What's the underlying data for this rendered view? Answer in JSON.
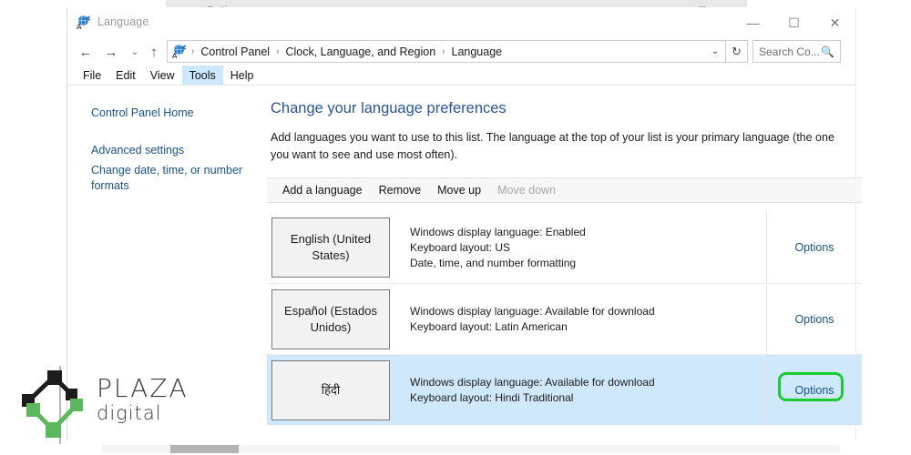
{
  "background_window": {
    "title": "Settings",
    "back_icon": "arrow-left-icon",
    "controls": [
      {
        "name": "minimize",
        "glyph": "—"
      },
      {
        "name": "maximize",
        "glyph": "☐"
      },
      {
        "name": "close",
        "glyph": "✕"
      }
    ]
  },
  "window": {
    "title": "Language",
    "icon": "language-globe-icon",
    "controls": [
      {
        "name": "minimize",
        "glyph": "—"
      },
      {
        "name": "maximize",
        "glyph": "☐"
      },
      {
        "name": "close",
        "glyph": "✕"
      }
    ]
  },
  "navigation": {
    "back": "←",
    "forward": "→",
    "recent": "⌄",
    "up": "↑",
    "breadcrumbs": [
      "Control Panel",
      "Clock, Language, and Region",
      "Language"
    ],
    "separator": "›",
    "chevron": "⌄",
    "refresh": "↻"
  },
  "search": {
    "placeholder": "Search Co...",
    "icon": "search-icon"
  },
  "menubar": {
    "items": [
      {
        "label": "File",
        "active": false
      },
      {
        "label": "Edit",
        "active": false
      },
      {
        "label": "View",
        "active": false
      },
      {
        "label": "Tools",
        "active": true
      },
      {
        "label": "Help",
        "active": false
      }
    ]
  },
  "sidebar": {
    "items": [
      {
        "label": "Control Panel Home"
      },
      {
        "label": "Advanced settings"
      },
      {
        "label": "Change date, time, or number"
      },
      {
        "label": "formats"
      }
    ]
  },
  "main": {
    "title": "Change your language preferences",
    "description": "Add languages you want to use to this list. The language at the top of your list is your primary language (the one you want to see and use most often).",
    "toolbar": [
      {
        "label": "Add a language",
        "disabled": false
      },
      {
        "label": "Remove",
        "disabled": false
      },
      {
        "label": "Move up",
        "disabled": false
      },
      {
        "label": "Move down",
        "disabled": true
      }
    ],
    "languages": [
      {
        "name": "English (United States)",
        "display_language": "Windows display language: Enabled",
        "keyboard_layout": "Keyboard layout: US",
        "extra": "Date, time, and number formatting",
        "options_label": "Options",
        "selected": false,
        "highlighted": false
      },
      {
        "name": "Español (Estados Unidos)",
        "display_language": "Windows display language: Available for download",
        "keyboard_layout": "Keyboard layout: Latin American",
        "extra": "",
        "options_label": "Options",
        "selected": false,
        "highlighted": false
      },
      {
        "name": "हिंदी",
        "display_language": "Windows display language: Available for download",
        "keyboard_layout": "Keyboard layout: Hindi Traditional",
        "extra": "",
        "options_label": "Options",
        "selected": true,
        "highlighted": true
      }
    ]
  },
  "watermark": {
    "brand": "PLAZA",
    "subbrand": "digital",
    "icon": "plaza-network-logo-icon"
  },
  "colors": {
    "link": "#16538c",
    "heading": "#2a5699",
    "selected_row": "#cfe8fc",
    "menu_active": "#cce8ff",
    "annotation_green": "#18cb2e",
    "logo_green": "#5cb85c",
    "logo_black": "#1c1c1c"
  }
}
